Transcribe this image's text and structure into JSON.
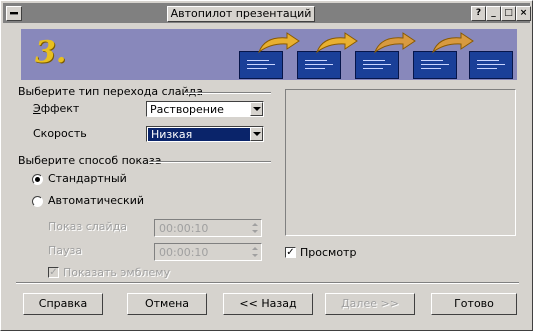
{
  "window": {
    "title": "Автопилот презентаций",
    "title_buttons": [
      "?",
      "_",
      "□",
      "×"
    ]
  },
  "banner": {
    "step": "3."
  },
  "transition": {
    "section_title": "Выберите тип перехода слайда",
    "effect_label": "Эффект",
    "effect_value": "Растворение",
    "speed_label": "Скорость",
    "speed_value": "Низкая"
  },
  "show": {
    "section_title": "Выберите способ показа",
    "standard_label": "Стандартный",
    "automatic_label": "Автоматический",
    "slide_duration_label": "Показ слайда",
    "slide_duration_value": "00:00:10",
    "pause_label": "Пауза",
    "pause_value": "00:00:10",
    "show_logo_label": "Показать эмблему"
  },
  "preview": {
    "checkbox_label": "Просмотр",
    "checked": true
  },
  "buttons": {
    "help": "Справка",
    "cancel": "Отмена",
    "back": "<< Назад",
    "next": "Далее >>",
    "finish": "Готово"
  },
  "colors": {
    "banner_bg": "#8888bb",
    "slide_fill": "#1a3f98",
    "arrow": "#e0a020",
    "selection": "#0a246a"
  }
}
